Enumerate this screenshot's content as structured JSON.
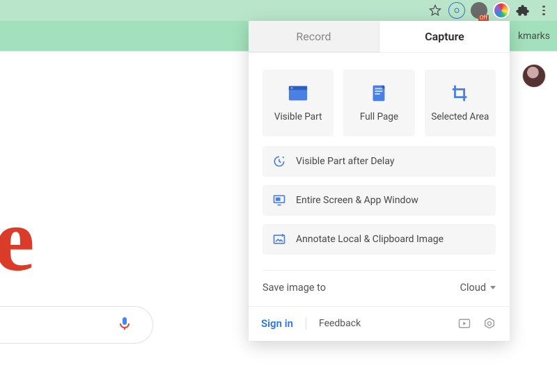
{
  "toolbar": {
    "badge": "Off"
  },
  "bookmarks_bar_text_fragment": "kmarks",
  "panel": {
    "tabs": {
      "record": "Record",
      "capture": "Capture",
      "active": "capture"
    },
    "primary": [
      {
        "id": "visible-part",
        "label": "Visible Part"
      },
      {
        "id": "full-page",
        "label": "Full Page"
      },
      {
        "id": "selected-area",
        "label": "Selected Area"
      }
    ],
    "secondary": [
      {
        "id": "visible-delay",
        "label": "Visible Part after Delay"
      },
      {
        "id": "entire-screen",
        "label": "Entire Screen & App Window"
      },
      {
        "id": "annotate-local",
        "label": "Annotate Local & Clipboard Image"
      }
    ],
    "save_label": "Save image to",
    "save_destination": "Cloud",
    "footer": {
      "signin": "Sign in",
      "feedback": "Feedback"
    }
  }
}
